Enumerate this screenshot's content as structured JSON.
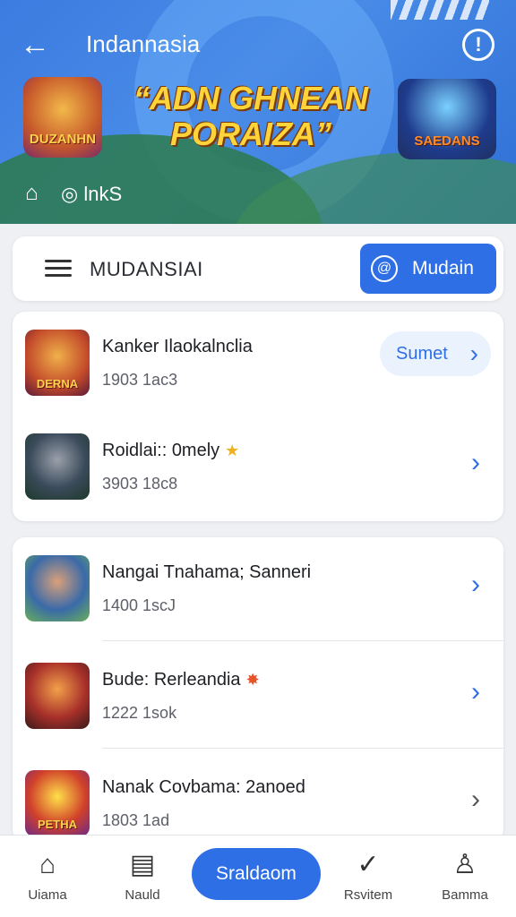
{
  "header": {
    "title": "Indannasia",
    "banner_headline": "“ADN GHNEAN PORAIZA”",
    "banner_left_label": "DUZANHN",
    "banner_right_label": "SAEDANS",
    "links_label": "lnkS",
    "colors": {
      "primary": "#2f6fe6",
      "banner_text": "#ffd33a"
    }
  },
  "searchbar": {
    "label": "MUDANSIAI",
    "button_label": "Mudain"
  },
  "list_top": [
    {
      "title": "Kanker Ilaokalnclia",
      "sub": "1903  1ac3",
      "thumb_label": "DERNA",
      "action_label": "Sumet"
    },
    {
      "title": "Roidlai:: 0mely",
      "sub": "3903  18c8",
      "badge": "★"
    }
  ],
  "list_bottom": [
    {
      "title": "Nangai Tnahama; Sanneri",
      "sub": "1400  1scJ"
    },
    {
      "title": "Bude: Rerleandia",
      "sub": "1222  1sok",
      "badge": "✸"
    },
    {
      "title": "Nanak Covbama: 2anoed",
      "sub": "1803  1ad",
      "thumb_label": "PETHA"
    }
  ],
  "bottom_nav": {
    "items": [
      {
        "label": "Uiama",
        "icon": "home-icon"
      },
      {
        "label": "Nauld",
        "icon": "news-icon"
      },
      {
        "label": "Rsvitem",
        "icon": "review-icon"
      },
      {
        "label": "Bamma",
        "icon": "profile-icon"
      }
    ],
    "center_label": "Sraldaom"
  }
}
